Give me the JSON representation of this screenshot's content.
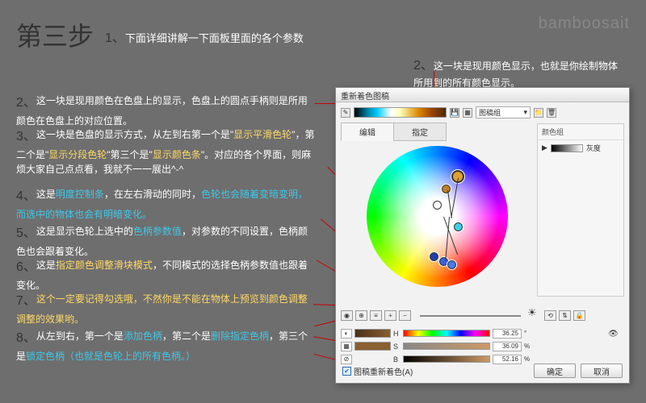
{
  "watermark": "bamboosait",
  "title": "第三步",
  "topnote": {
    "num": "1、",
    "text": "下面详细讲解一下面板里面的各个参数"
  },
  "right_note": {
    "num": "2、",
    "text": "这一块是现用颜色显示，也就是你绘制物体所用到的所有颜色显示。"
  },
  "annots": {
    "a1": {
      "num": "2、",
      "t": "这一块是现用颜色在色盘上的显示，色盘上的圆点手柄则是所用颜色在色盘上的对应位置。"
    },
    "a2": {
      "num": "3、",
      "p1": "这一块是色盘的显示方式，从左到右第一个是\"",
      "y1": "显示平滑色轮",
      "p2": "\"，第二个是\"",
      "y2": "显示分段色轮",
      "p3": "\"第三个是\"",
      "y3": "显示颜色条",
      "p4": "\"。对应的各个界面，则麻烦大家自己点点看，我就不一一展出^-^"
    },
    "a3": {
      "num": "4、",
      "p1": "这是",
      "c1": "明度控制条",
      "p2": "，在左右滑动的同时，",
      "c2": "色轮也会随着变暗变明，而选中的物体也会有明暗变化。"
    },
    "a4": {
      "num": "5、",
      "p1": "这是显示色轮上选中的",
      "c1": "色柄参数值",
      "p2": "，对参数的不同设置，色柄颜色也会跟着变化。"
    },
    "a5": {
      "num": "6、",
      "p1": "这是",
      "y1": "指定颜色调整滑块模式",
      "p2": "，不同模式的选择色柄参数值也跟着变化。"
    },
    "a6": {
      "num": "7、",
      "y": "这个一定要记得勾选哦，不然你是不能在物体上预览到颜色调整调整的效果哟。"
    },
    "a7": {
      "num": "8、",
      "p1": "从左到右，第一个是",
      "c1": "添加色柄",
      "p2": "，第二个是",
      "c2": "删除指定色柄",
      "p3": "，第三个是",
      "c3": "锁定色柄（也就是色轮上的所有色柄。）"
    }
  },
  "dialog": {
    "title": "重新着色图稿",
    "dropdown": "图稿组",
    "tabs": {
      "edit": "编辑",
      "assign": "指定"
    },
    "side": {
      "header": "颜色组",
      "row1": "灰度"
    },
    "hsb": {
      "h": {
        "label": "H",
        "val": "36.25",
        "pct": "°"
      },
      "s": {
        "label": "S",
        "val": "36.09",
        "pct": "%"
      },
      "b": {
        "label": "B",
        "val": "52.16",
        "pct": "%"
      }
    },
    "checkbox": "图稿重新着色(A)",
    "ok": "确定",
    "cancel": "取消"
  }
}
